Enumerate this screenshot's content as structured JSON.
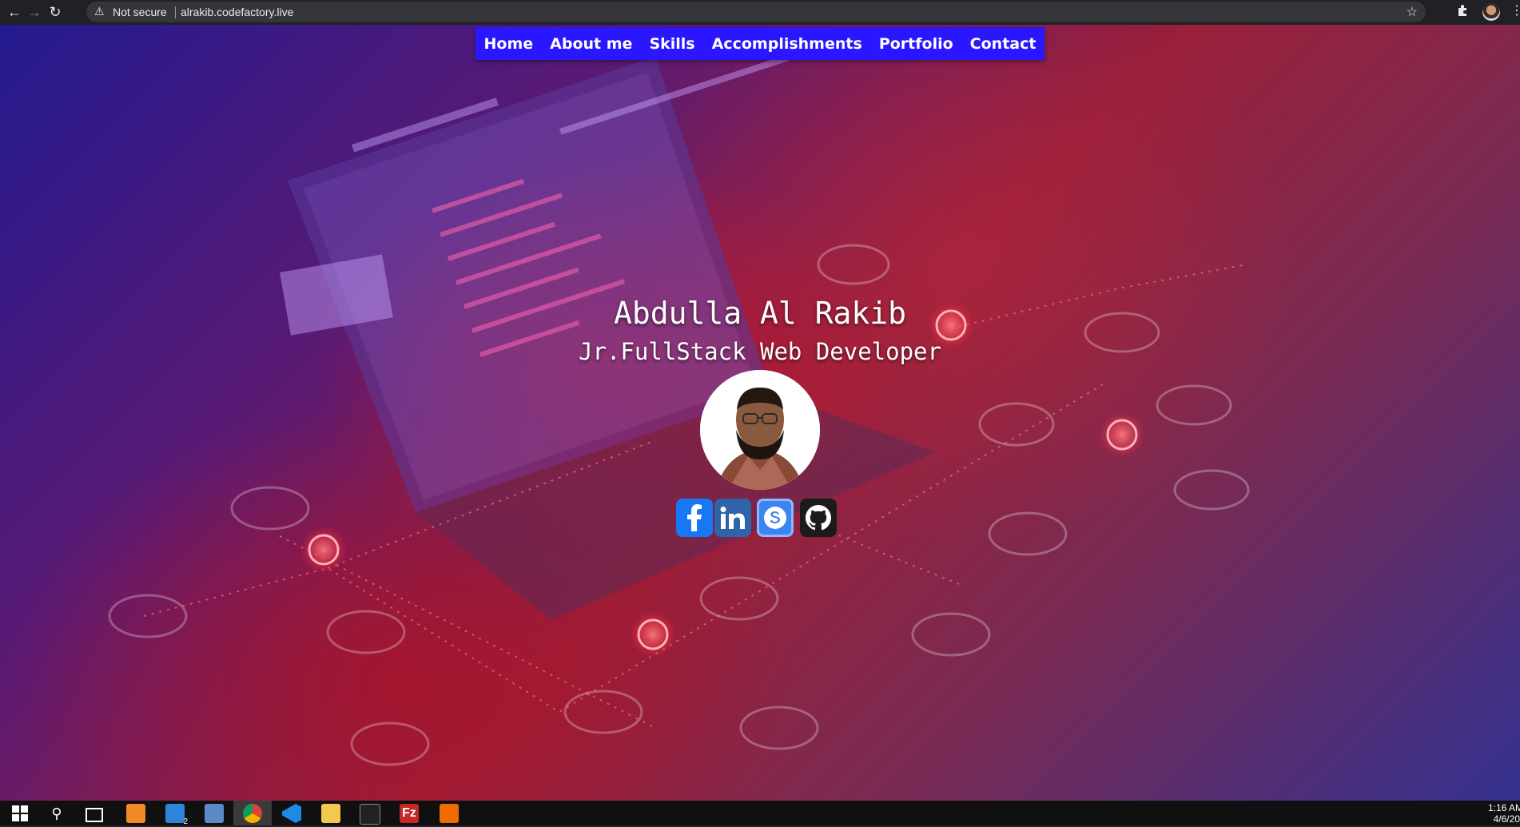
{
  "browser": {
    "security_label": "Not secure",
    "url": "alrakib.codefactory.live"
  },
  "nav": {
    "items": [
      "Home",
      "About me",
      "Skills",
      "Accomplishments",
      "Portfolio",
      "Contact"
    ]
  },
  "hero": {
    "name": "Abdulla Al Rakib",
    "title": "Jr.FullStack Web Developer",
    "avatar_alt": "profile photo"
  },
  "social": [
    {
      "name": "facebook",
      "color": "#1877f2"
    },
    {
      "name": "linkedin",
      "color": "#2f64a8"
    },
    {
      "name": "skype",
      "color": "#3a86f0"
    },
    {
      "name": "github",
      "color": "#1b1b1b"
    }
  ],
  "taskbar": {
    "mail_badge": "2",
    "time": "1:16 AM",
    "date": "4/6/20"
  }
}
